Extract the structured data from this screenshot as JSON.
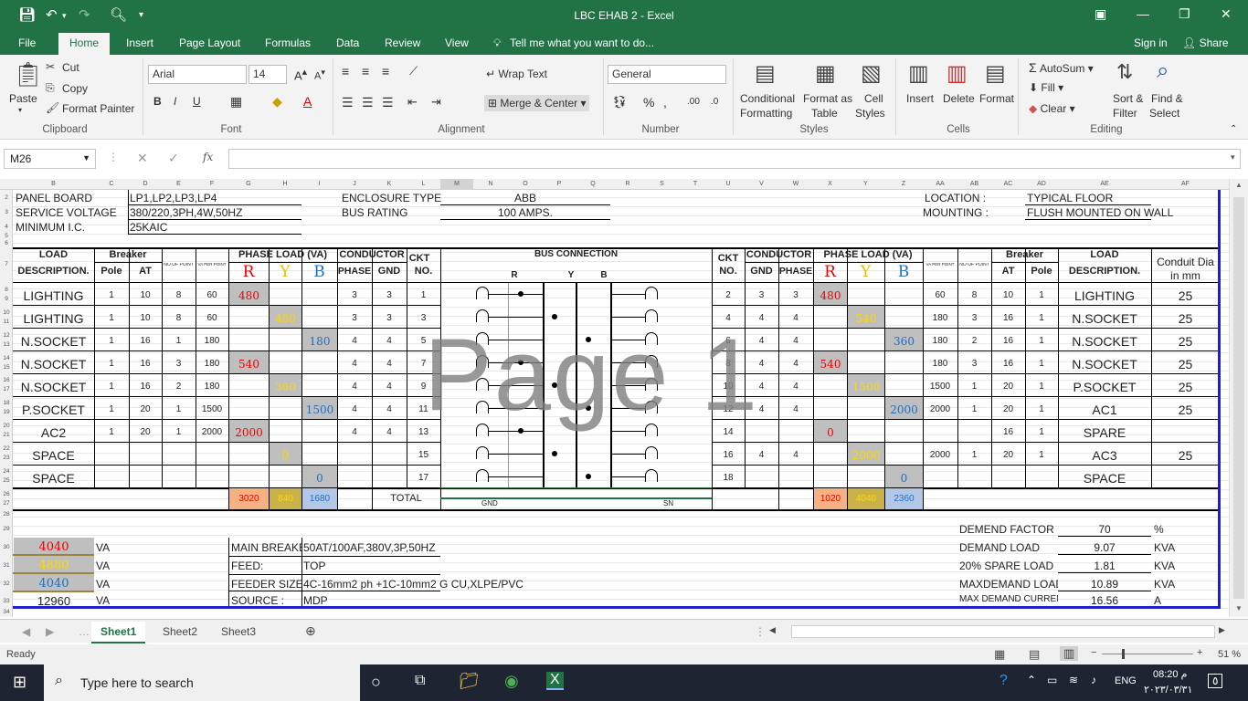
{
  "window": {
    "title": "LBC  EHAB 2 - Excel",
    "sign_in": "Sign in",
    "share": "Share"
  },
  "tabs": [
    "File",
    "Home",
    "Insert",
    "Page Layout",
    "Formulas",
    "Data",
    "Review",
    "View",
    "Tell me what you want to do..."
  ],
  "ribbon": {
    "paste": "Paste",
    "cut": "Cut",
    "copy": "Copy",
    "format_painter": "Format Painter",
    "clipboard": "Clipboard",
    "font_name": "Arial",
    "font_size": "14",
    "font": "Font",
    "wrap_text": "Wrap Text",
    "merge_center": "Merge & Center",
    "alignment": "Alignment",
    "number_format": "General",
    "number": "Number",
    "cond_fmt1": "Conditional",
    "cond_fmt2": "Formatting",
    "fmt_table1": "Format as",
    "fmt_table2": "Table",
    "cell_styles1": "Cell",
    "cell_styles2": "Styles",
    "styles": "Styles",
    "insert": "Insert",
    "delete": "Delete",
    "format": "Format",
    "cells": "Cells",
    "autosum": "AutoSum",
    "fill": "Fill",
    "clear": "Clear",
    "sort1": "Sort &",
    "sort2": "Filter",
    "find1": "Find &",
    "find2": "Select",
    "editing": "Editing",
    "bold": "B",
    "italic": "I",
    "underline": "U"
  },
  "formula_bar": {
    "name_box": "M26",
    "fx": "fx",
    "value": ""
  },
  "columns": [
    "B",
    "C",
    "D",
    "E",
    "F",
    "G",
    "H",
    "I",
    "J",
    "K",
    "L",
    "M",
    "N",
    "O",
    "P",
    "Q",
    "R",
    "S",
    "T",
    "U",
    "V",
    "W",
    "X",
    "Y",
    "Z",
    "AA",
    "AB",
    "AC",
    "AD",
    "AE",
    "AF"
  ],
  "rows": [
    "2",
    "3",
    "4",
    "5",
    "6",
    "7",
    "8",
    "9",
    "10",
    "11",
    "12",
    "13",
    "14",
    "15",
    "16",
    "17",
    "18",
    "19",
    "20",
    "21",
    "22",
    "23",
    "24",
    "25",
    "26",
    "27",
    "28",
    "29",
    "30",
    "31",
    "32",
    "33",
    "34"
  ],
  "header": {
    "panel_board_lbl": "PANEL BOARD",
    "panel_board": "LP1,LP2,LP3,LP4",
    "service_voltage_lbl": "SERVICE VOLTAGE",
    "service_voltage": "380/220,3PH,4W,50HZ",
    "min_ic_lbl": "MINIMUM I.C.",
    "min_ic": "25KAIC",
    "enclosure_lbl": "ENCLOSURE TYPE",
    "enclosure": "ABB",
    "bus_rating_lbl": "BUS RATING",
    "bus_rating": "100 AMPS.",
    "location_lbl": "LOCATION :",
    "location": "TYPICAL FLOOR",
    "mounting_lbl": "MOUNTING :",
    "mounting": "FLUSH MOUNTED ON WALL"
  },
  "table_head": {
    "load": "LOAD",
    "description": "DESCRIPTION.",
    "breaker": "Breaker",
    "pole": "Pole",
    "at": "AT",
    "no_of_point": "NO OF POINT",
    "va_per_point": "VA PER POINT",
    "phase_load": "PHASE LOAD (VA)",
    "r": "R",
    "y": "Y",
    "b": "B",
    "conductor": "CONDUCTOR",
    "phase": "PHASE",
    "gnd": "GND",
    "ckt": "CKT",
    "no": "NO.",
    "bus_connection": "BUS CONNECTION",
    "conduit1": "Conduit Dia",
    "conduit2": "in mm"
  },
  "left_rows": [
    {
      "desc": "LIGHTING",
      "pole": "1",
      "at": "10",
      "pts": "8",
      "va": "60",
      "r": "480",
      "y": "",
      "b": "",
      "ph": "3",
      "gnd": "3",
      "ckt": "1"
    },
    {
      "desc": "LIGHTING",
      "pole": "1",
      "at": "10",
      "pts": "8",
      "va": "60",
      "r": "",
      "y": "480",
      "b": "",
      "ph": "3",
      "gnd": "3",
      "ckt": "3"
    },
    {
      "desc": "N.SOCKET",
      "pole": "1",
      "at": "16",
      "pts": "1",
      "va": "180",
      "r": "",
      "y": "",
      "b": "180",
      "ph": "4",
      "gnd": "4",
      "ckt": "5"
    },
    {
      "desc": "N.SOCKET",
      "pole": "1",
      "at": "16",
      "pts": "3",
      "va": "180",
      "r": "540",
      "y": "",
      "b": "",
      "ph": "4",
      "gnd": "4",
      "ckt": "7"
    },
    {
      "desc": "N.SOCKET",
      "pole": "1",
      "at": "16",
      "pts": "2",
      "va": "180",
      "r": "",
      "y": "360",
      "b": "",
      "ph": "4",
      "gnd": "4",
      "ckt": "9"
    },
    {
      "desc": "P.SOCKET",
      "pole": "1",
      "at": "20",
      "pts": "1",
      "va": "1500",
      "r": "",
      "y": "",
      "b": "1500",
      "ph": "4",
      "gnd": "4",
      "ckt": "11"
    },
    {
      "desc": "AC2",
      "pole": "1",
      "at": "20",
      "pts": "1",
      "va": "2000",
      "r": "2000",
      "y": "",
      "b": "",
      "ph": "4",
      "gnd": "4",
      "ckt": "13"
    },
    {
      "desc": "SPACE",
      "pole": "",
      "at": "",
      "pts": "",
      "va": "",
      "r": "",
      "y": "0",
      "b": "",
      "ph": "",
      "gnd": "",
      "ckt": "15"
    },
    {
      "desc": "SPACE",
      "pole": "",
      "at": "",
      "pts": "",
      "va": "",
      "r": "",
      "y": "",
      "b": "0",
      "ph": "",
      "gnd": "",
      "ckt": "17"
    }
  ],
  "right_rows": [
    {
      "ckt": "2",
      "gnd": "3",
      "ph": "3",
      "r": "480",
      "y": "",
      "b": "",
      "va": "60",
      "pts": "8",
      "at": "10",
      "pole": "1",
      "desc": "LIGHTING",
      "conduit": "25"
    },
    {
      "ckt": "4",
      "gnd": "4",
      "ph": "4",
      "r": "",
      "y": "540",
      "b": "",
      "va": "180",
      "pts": "3",
      "at": "16",
      "pole": "1",
      "desc": "N.SOCKET",
      "conduit": "25"
    },
    {
      "ckt": "6",
      "gnd": "4",
      "ph": "4",
      "r": "",
      "y": "",
      "b": "360",
      "va": "180",
      "pts": "2",
      "at": "16",
      "pole": "1",
      "desc": "N.SOCKET",
      "conduit": "25"
    },
    {
      "ckt": "8",
      "gnd": "4",
      "ph": "4",
      "r": "540",
      "y": "",
      "b": "",
      "va": "180",
      "pts": "3",
      "at": "16",
      "pole": "1",
      "desc": "N.SOCKET",
      "conduit": "25"
    },
    {
      "ckt": "10",
      "gnd": "4",
      "ph": "4",
      "r": "",
      "y": "1500",
      "b": "",
      "va": "1500",
      "pts": "1",
      "at": "20",
      "pole": "1",
      "desc": "P.SOCKET",
      "conduit": "25"
    },
    {
      "ckt": "12",
      "gnd": "4",
      "ph": "4",
      "r": "",
      "y": "",
      "b": "2000",
      "va": "2000",
      "pts": "1",
      "at": "20",
      "pole": "1",
      "desc": "AC1",
      "conduit": "25"
    },
    {
      "ckt": "14",
      "gnd": "",
      "ph": "",
      "r": "0",
      "y": "",
      "b": "",
      "va": "",
      "pts": "",
      "at": "16",
      "pole": "1",
      "desc": "SPARE",
      "conduit": ""
    },
    {
      "ckt": "16",
      "gnd": "4",
      "ph": "4",
      "r": "",
      "y": "2000",
      "b": "",
      "va": "2000",
      "pts": "1",
      "at": "20",
      "pole": "1",
      "desc": "AC3",
      "conduit": "25"
    },
    {
      "ckt": "18",
      "gnd": "",
      "ph": "",
      "r": "",
      "y": "",
      "b": "0",
      "va": "",
      "pts": "",
      "at": "",
      "pole": "",
      "desc": "SPACE",
      "conduit": ""
    }
  ],
  "bus": {
    "r": "R",
    "y": "Y",
    "b": "B",
    "gnd": "GND",
    "sn": "SN"
  },
  "totals": {
    "left_r": "3020",
    "left_y": "840",
    "left_b": "1680",
    "label": "TOTAL",
    "right_r": "1020",
    "right_y": "4040",
    "right_b": "2360"
  },
  "summary": {
    "r_total": "4040",
    "y_total": "4880",
    "b_total": "4040",
    "grand_total": "12960",
    "unit": "VA"
  },
  "main_info": {
    "main_breaker_lbl": "MAIN BREAKER",
    "main_breaker": "50AT/100AF,380V,3P,50HZ",
    "feed_lbl": "FEED:",
    "feed": "TOP",
    "feeder_lbl": "FEEDER SIZE",
    "feeder": "4C-16mm2 ph +1C-10mm2 G CU,XLPE/PVC",
    "source_lbl": "SOURCE :",
    "source": "MDP"
  },
  "demand": [
    {
      "label": "DEMEND FACTOR",
      "value": "70",
      "unit": "%"
    },
    {
      "label": "DEMAND LOAD",
      "value": "9.07",
      "unit": "KVA"
    },
    {
      "label": "20% SPARE LOAD",
      "value": "1.81",
      "unit": "KVA"
    },
    {
      "label": "MAXDEMAND LOAD",
      "value": "10.89",
      "unit": "KVA"
    },
    {
      "label": "MAX DEMAND CURRENT",
      "value": "16.56",
      "unit": "A"
    }
  ],
  "watermark": "Page 1",
  "sheet_tabs": [
    "Sheet1",
    "Sheet2",
    "Sheet3"
  ],
  "status": {
    "ready": "Ready",
    "zoom": "51 %"
  },
  "taskbar": {
    "search": "Type here to search",
    "lang": "ENG",
    "time": "08:20 م",
    "date": "٢٠٢٣/٠٣/٣١",
    "notif": "٥"
  },
  "colors": {
    "excel_green": "#217346",
    "red_fill": "#f4b183",
    "yellow_fill": "#c9b24a",
    "blue_fill": "#b4c7e7",
    "grey_fill": "#bfbfbf",
    "border_blue": "#1f1fd0"
  }
}
